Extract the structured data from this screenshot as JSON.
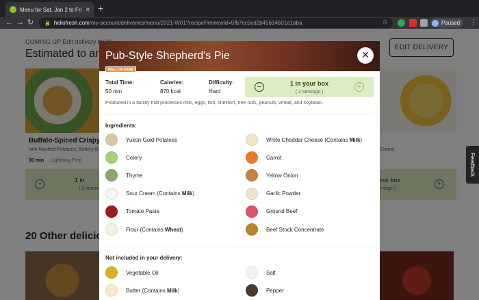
{
  "browser": {
    "tab_title": "Menu for Sat, Jan 2 to Fri, Jan 8",
    "tab_close": "✕",
    "new_tab": "+",
    "url_host": "hellofresh.com",
    "url_path": "/my-account/deliveries/menu/2021-W01?recipePreviewId=5fb7ec5cd2b45b14601e1aba",
    "profile_label": "Paused",
    "back": "←",
    "forward": "→",
    "reload": "↻",
    "star": "☆",
    "menu": "⋮",
    "lock": "🔒"
  },
  "page": {
    "coming_up": "COMING UP  Edit delivery by W",
    "estimated": "Estimated to arri",
    "edit_delivery": "EDIT DELIVERY",
    "left_card": {
      "title": "Buffalo-Spiced Crispy Chi",
      "subtitle": "with Mashed Potatoes, Buttery B",
      "time": "30 min",
      "tag": "Lightning Prep",
      "in_box": "1 in",
      "servings": "( 2 servings"
    },
    "right_card": {
      "subtitle": "Crema",
      "in_box": "our box",
      "servings": "rvings )"
    },
    "other_heading": "20 Other deliciou",
    "feedback": "Feedback"
  },
  "modal": {
    "title": "Pub-Style Shepherd's Pie",
    "badge": "HALL OF FAME",
    "close": "✕",
    "stats": [
      {
        "label": "Total Time:",
        "value": "50 min"
      },
      {
        "label": "Calories:",
        "value": "870 kcal"
      },
      {
        "label": "Difficulty:",
        "value": "Hard"
      }
    ],
    "in_box": "1 in your box",
    "servings": "( 2 servings )",
    "minus": "−",
    "plus": "+",
    "allergen_note": "Produced in a facility that processes milk, eggs, fish, shellfish, tree nuts, peanuts, wheat, and soybean.",
    "ingredients_heading": "Ingredients:",
    "ingredients_left": [
      {
        "name": "Yukon Gold Potatoes",
        "icon": "potato-icon",
        "color": "#d9c7a0"
      },
      {
        "name": "Celery",
        "icon": "celery-icon",
        "color": "#a9cf73"
      },
      {
        "name": "Thyme",
        "icon": "thyme-icon",
        "color": "#8aa86a"
      },
      {
        "name": "Sour Cream (Contains ",
        "bold": "Milk",
        "suffix": ")",
        "icon": "sour-cream-icon",
        "color": "#f4f4f0"
      },
      {
        "name": "Tomato Paste",
        "icon": "tomato-paste-icon",
        "color": "#9b1c1c"
      },
      {
        "name": "Flour (Contains ",
        "bold": "Wheat",
        "suffix": ")",
        "icon": "flour-icon",
        "color": "#f3efe2"
      }
    ],
    "ingredients_right": [
      {
        "name": "White Cheddar Cheese (Contains ",
        "bold": "Milk",
        "suffix": ")",
        "icon": "cheese-icon",
        "color": "#efe6c8"
      },
      {
        "name": "Carrot",
        "icon": "carrot-icon",
        "color": "#e67c2e"
      },
      {
        "name": "Yellow Onion",
        "icon": "onion-icon",
        "color": "#c9823e"
      },
      {
        "name": "Garlic Powder",
        "icon": "garlic-powder-icon",
        "color": "#efe3cc"
      },
      {
        "name": "Ground Beef",
        "icon": "ground-beef-icon",
        "color": "#d9556a"
      },
      {
        "name": "Beef Stock Concentrate",
        "icon": "beef-stock-icon",
        "color": "#b8862c"
      }
    ],
    "not_included_heading": "Not included in your delivery:",
    "not_included_left": [
      {
        "name": "Vegetable Oil",
        "icon": "vegetable-oil-icon",
        "color": "#d9b21c"
      },
      {
        "name": "Butter (Contains ",
        "bold": "Milk",
        "suffix": ")",
        "icon": "butter-icon",
        "color": "#f6edc7"
      }
    ],
    "not_included_right": [
      {
        "name": "Salt",
        "icon": "salt-icon",
        "color": "#f2f2f2"
      },
      {
        "name": "Pepper",
        "icon": "pepper-icon",
        "color": "#4a3a30"
      }
    ]
  }
}
